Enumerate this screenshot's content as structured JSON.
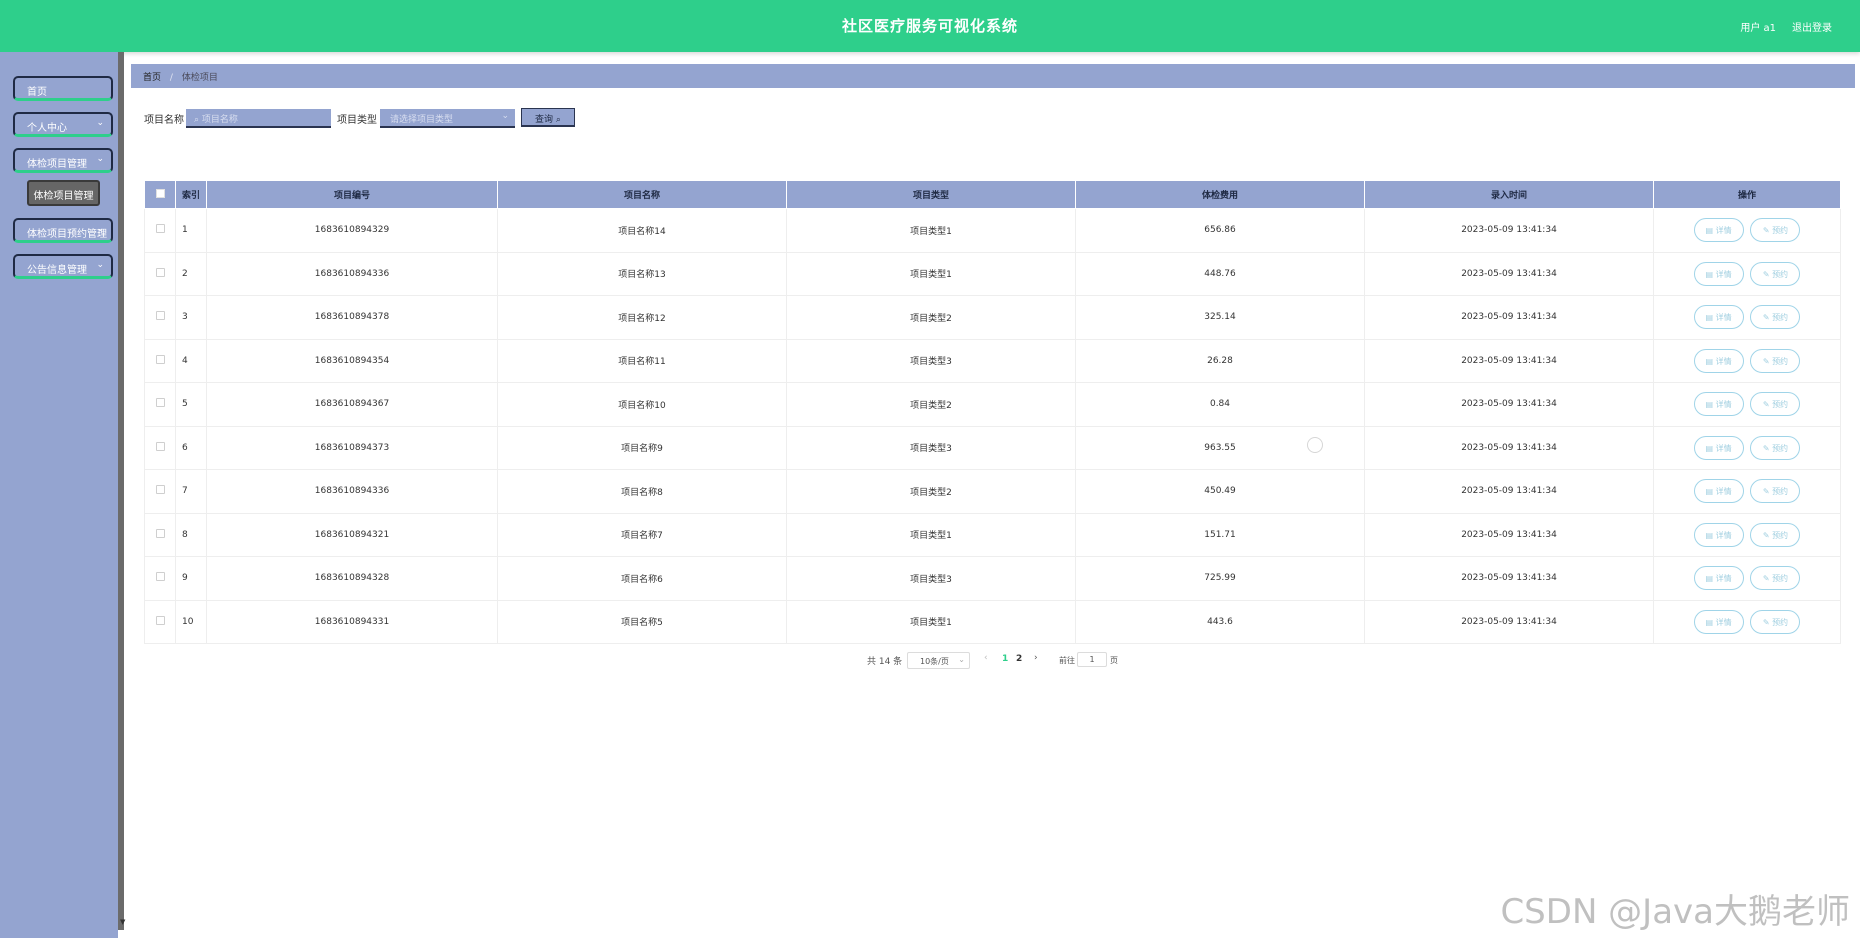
{
  "header": {
    "title": "社区医疗服务可视化系统",
    "user": "用户 a1",
    "logout": "退出登录"
  },
  "sidebar": {
    "items": [
      {
        "label": "首页",
        "has_chevron": false
      },
      {
        "label": "个人中心",
        "has_chevron": true
      },
      {
        "label": "体检项目管理",
        "has_chevron": true
      },
      {
        "label": "体检项目预约管理",
        "has_chevron": true
      },
      {
        "label": "公告信息管理",
        "has_chevron": true
      }
    ],
    "subitem": "体检项目管理"
  },
  "breadcrumb": {
    "home": "首页",
    "sep": "/",
    "current": "体检项目"
  },
  "filters": {
    "name_label": "项目名称",
    "name_placeholder": "项目名称",
    "type_label": "项目类型",
    "type_placeholder": "请选择项目类型",
    "query_label": "查询"
  },
  "table": {
    "headers": [
      "索引",
      "项目编号",
      "项目名称",
      "项目类型",
      "体检费用",
      "录入时间",
      "操作"
    ],
    "detail_label": "详情",
    "book_label": "预约",
    "rows": [
      {
        "index": "1",
        "code": "1683610894329",
        "name": "项目名称14",
        "type": "项目类型1",
        "fee": "656.86",
        "time": "2023-05-09 13:41:34"
      },
      {
        "index": "2",
        "code": "1683610894336",
        "name": "项目名称13",
        "type": "项目类型1",
        "fee": "448.76",
        "time": "2023-05-09 13:41:34"
      },
      {
        "index": "3",
        "code": "1683610894378",
        "name": "项目名称12",
        "type": "项目类型2",
        "fee": "325.14",
        "time": "2023-05-09 13:41:34"
      },
      {
        "index": "4",
        "code": "1683610894354",
        "name": "项目名称11",
        "type": "项目类型3",
        "fee": "26.28",
        "time": "2023-05-09 13:41:34"
      },
      {
        "index": "5",
        "code": "1683610894367",
        "name": "项目名称10",
        "type": "项目类型2",
        "fee": "0.84",
        "time": "2023-05-09 13:41:34"
      },
      {
        "index": "6",
        "code": "1683610894373",
        "name": "项目名称9",
        "type": "项目类型3",
        "fee": "963.55",
        "time": "2023-05-09 13:41:34"
      },
      {
        "index": "7",
        "code": "1683610894336",
        "name": "项目名称8",
        "type": "项目类型2",
        "fee": "450.49",
        "time": "2023-05-09 13:41:34"
      },
      {
        "index": "8",
        "code": "1683610894321",
        "name": "项目名称7",
        "type": "项目类型1",
        "fee": "151.71",
        "time": "2023-05-09 13:41:34"
      },
      {
        "index": "9",
        "code": "1683610894328",
        "name": "项目名称6",
        "type": "项目类型3",
        "fee": "725.99",
        "time": "2023-05-09 13:41:34"
      },
      {
        "index": "10",
        "code": "1683610894331",
        "name": "项目名称5",
        "type": "项目类型1",
        "fee": "443.6",
        "time": "2023-05-09 13:41:34"
      }
    ]
  },
  "pager": {
    "total": "共 14 条",
    "page_size": "10条/页",
    "page1": "1",
    "page2": "2",
    "goto_label": "前往",
    "goto_value": "1",
    "page_unit": "页"
  },
  "watermark": "CSDN @Java大鹅老师",
  "colors": {
    "header": "#2ecf8b",
    "sidebar": "#94a4d0",
    "accent_border": "#2ecf8b"
  }
}
